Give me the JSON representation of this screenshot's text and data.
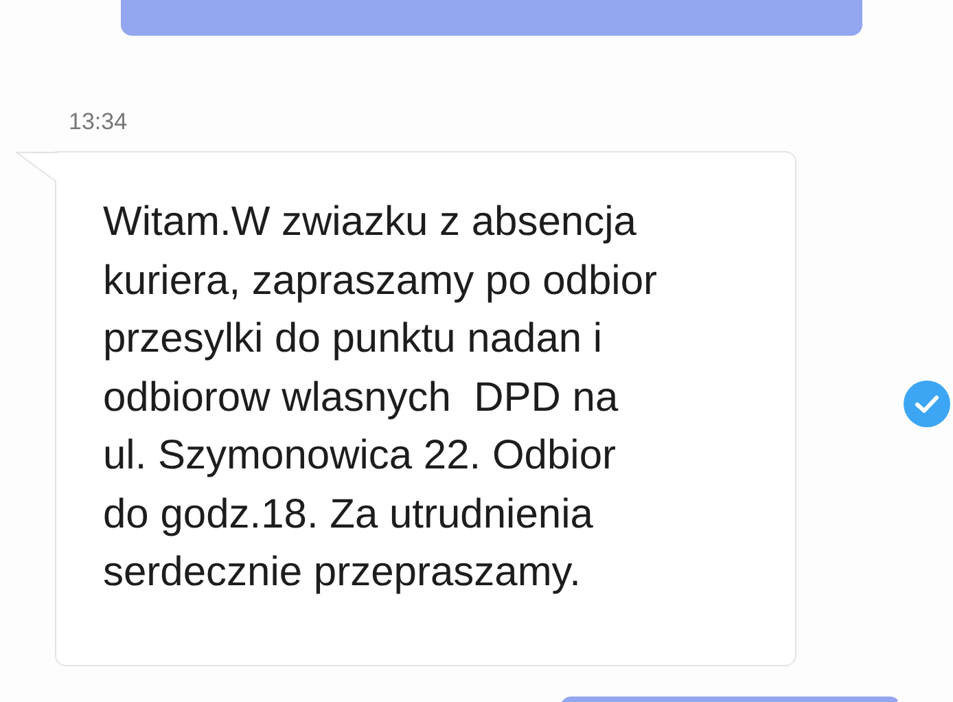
{
  "messages": [
    {
      "kind": "outgoing"
    },
    {
      "kind": "incoming",
      "time": "13:34",
      "text": "Witam.W zwiazku z absencja\nkuriera, zapraszamy po odbior\nprzesylki do punktu nadan i\nodbiorow wlasnych  DPD na\nul. Szymonowica 22. Odbior\ndo godz.18. Za utrudnienia\nserdecznie przepraszamy.",
      "selected": true
    },
    {
      "kind": "outgoing"
    }
  ]
}
